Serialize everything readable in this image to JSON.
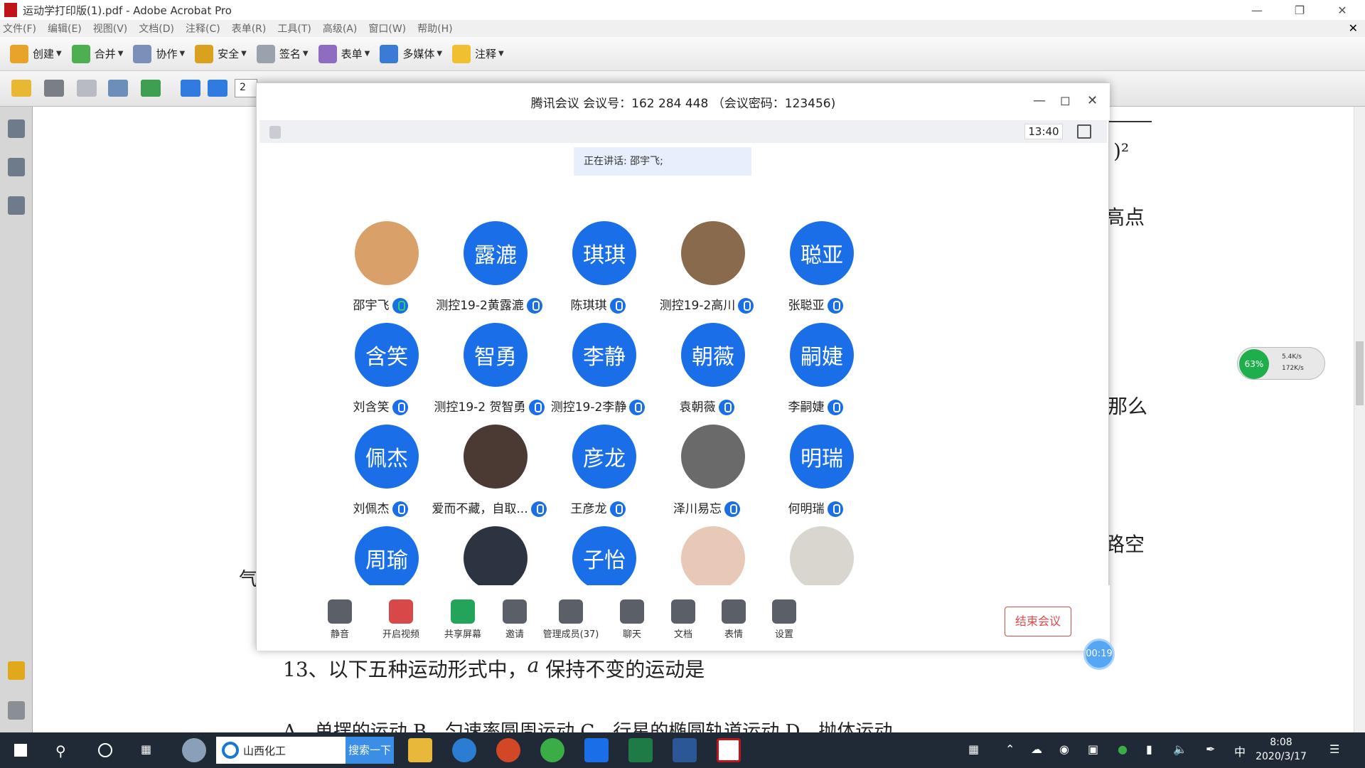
{
  "acrobat": {
    "window_title": "运动学打印版(1).pdf - Adobe Acrobat Pro",
    "menus": [
      "文件(F)",
      "编辑(E)",
      "视图(V)",
      "文档(D)",
      "注释(C)",
      "表单(R)",
      "工具(T)",
      "高级(A)",
      "窗口(W)",
      "帮助(H)"
    ],
    "toolbar": [
      {
        "label": "创建",
        "icon": "create-icon"
      },
      {
        "label": "合并",
        "icon": "combine-icon"
      },
      {
        "label": "协作",
        "icon": "collaborate-icon"
      },
      {
        "label": "安全",
        "icon": "lock-icon"
      },
      {
        "label": "签名",
        "icon": "pen-icon"
      },
      {
        "label": "表单",
        "icon": "form-icon"
      },
      {
        "label": "多媒体",
        "icon": "multimedia-icon"
      },
      {
        "label": "注释",
        "icon": "comment-icon"
      }
    ],
    "page_number": "2",
    "doc_question": "13、以下五种运动形式中，",
    "doc_vector": "a",
    "doc_question_end": "保持不变的运动是",
    "doc_options": "A．单摆的运动    B．匀速率圆周运动    C．行星的椭圆轨道运动    D．抛体运动",
    "doc_fragments": {
      "superscript": ")²",
      "gaodian": "高点",
      "name_left": "气",
      "namo": "那么",
      "lukong": "路空"
    }
  },
  "meeting": {
    "title": "腾讯会议 会议号：162 284 448  （会议密码：123456)",
    "clock": "13:40",
    "speaking": "正在讲话: 邵宇飞;",
    "participants": [
      {
        "avatar_text": "",
        "photo": "shiba-dog-photo",
        "name": "邵宇飞",
        "mic": "active"
      },
      {
        "avatar_text": "露漉",
        "name": "测控19-2黄露漉",
        "mic": "on"
      },
      {
        "avatar_text": "琪琪",
        "name": "陈琪琪",
        "mic": "on"
      },
      {
        "avatar_text": "",
        "photo": "teddy-bear-photo",
        "name": "测控19-2高川",
        "mic": "on"
      },
      {
        "avatar_text": "聪亚",
        "name": "张聪亚",
        "mic": "on"
      },
      {
        "avatar_text": "含笑",
        "name": "刘含笑",
        "mic": "on"
      },
      {
        "avatar_text": "智勇",
        "name": "测控19-2 贺智勇",
        "mic": "on"
      },
      {
        "avatar_text": "李静",
        "name": "测控19-2李静",
        "mic": "on"
      },
      {
        "avatar_text": "朝薇",
        "name": "袁朝薇",
        "mic": "on"
      },
      {
        "avatar_text": "嗣婕",
        "name": "李嗣婕",
        "mic": "on"
      },
      {
        "avatar_text": "佩杰",
        "name": "刘佩杰",
        "mic": "on"
      },
      {
        "avatar_text": "",
        "photo": "person-photo",
        "name": "爱而不藏，自取...",
        "mic": "on"
      },
      {
        "avatar_text": "彦龙",
        "name": "王彦龙",
        "mic": "on"
      },
      {
        "avatar_text": "",
        "photo": "person-hat-photo",
        "name": "泽川易忘",
        "mic": "on"
      },
      {
        "avatar_text": "明瑞",
        "name": "何明瑞",
        "mic": "on"
      },
      {
        "avatar_text": "周瑜",
        "name": "",
        "mic": ""
      },
      {
        "avatar_text": "",
        "photo": "class-photo",
        "name": "",
        "mic": ""
      },
      {
        "avatar_text": "子怡",
        "name": "",
        "mic": ""
      },
      {
        "avatar_text": "",
        "photo": "portrait-photo",
        "name": "",
        "mic": ""
      },
      {
        "avatar_text": "",
        "photo": "white-dog-photo",
        "name": "",
        "mic": ""
      }
    ],
    "controls": [
      {
        "label": "静音",
        "icon": "microphone-icon"
      },
      {
        "label": "开启视频",
        "icon": "camera-off-icon"
      },
      {
        "label": "共享屏幕",
        "icon": "share-screen-icon"
      },
      {
        "label": "邀请",
        "icon": "invite-icon"
      },
      {
        "label": "管理成员(37)",
        "icon": "members-icon"
      },
      {
        "label": "聊天",
        "icon": "chat-icon"
      },
      {
        "label": "文档",
        "icon": "document-icon"
      },
      {
        "label": "表情",
        "icon": "emoji-icon"
      },
      {
        "label": "设置",
        "icon": "settings-icon"
      }
    ],
    "end_label": "结束会议",
    "timer": "00:19"
  },
  "netwidget": {
    "percent": "63%",
    "up": "5.4K/s",
    "down": "172K/s"
  },
  "taskbar": {
    "search_text": "山西化工",
    "search_button": "搜索一下",
    "time": "8:08",
    "date": "2020/3/17",
    "ime": "中"
  },
  "colors": {
    "accent": "#1a6fe8",
    "end": "#e0484b",
    "taskbar": "#1f2a36"
  }
}
